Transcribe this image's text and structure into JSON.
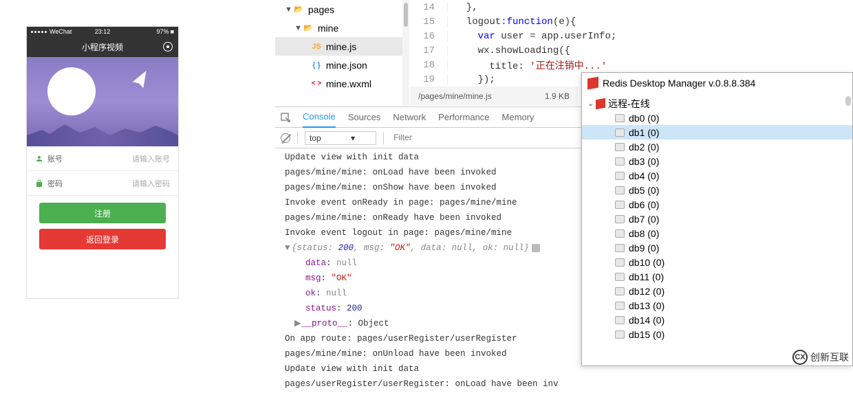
{
  "phone": {
    "statusbar": {
      "carrier": "WeChat",
      "time": "23:12",
      "battery": "97%"
    },
    "title": "小程序视频",
    "form": {
      "account_label": "账号",
      "account_placeholder": "请输入账号",
      "password_label": "密码",
      "password_placeholder": "请输入密码"
    },
    "buttons": {
      "register": "注册",
      "back_login": "返回登录"
    }
  },
  "filetree": {
    "folders": [
      "pages",
      "mine"
    ],
    "files": [
      {
        "icon": "JS",
        "name": "mine.js",
        "cls": "ic-js",
        "sel": true
      },
      {
        "icon": "{ }",
        "name": "mine.json",
        "cls": "ic-json",
        "sel": false
      },
      {
        "icon": "< >",
        "name": "mine.wxml",
        "cls": "ic-wxml",
        "sel": false
      }
    ]
  },
  "code": {
    "lines": [
      {
        "n": 14,
        "txt": "  },"
      },
      {
        "n": 15,
        "txt": "  logout:",
        "fn": "function",
        "after": "(e){"
      },
      {
        "n": 16,
        "txt": "    ",
        "kw": "var",
        "after": " user = app.userInfo;"
      },
      {
        "n": 17,
        "txt": "    wx.showLoading({"
      },
      {
        "n": 18,
        "txt": "      title: ",
        "str": "'正在注销中...'"
      },
      {
        "n": 19,
        "txt": "    });"
      }
    ]
  },
  "footer": {
    "path": "/pages/mine/mine.js",
    "size": "1.9 KB"
  },
  "devtools": {
    "tabs": [
      "Console",
      "Sources",
      "Network",
      "Performance",
      "Memory"
    ],
    "active_tab": 0,
    "context": "top",
    "filter_placeholder": "Filter",
    "log": [
      {
        "t": "plain",
        "v": "Update view with init data"
      },
      {
        "t": "plain",
        "v": "pages/mine/mine: onLoad have been invoked"
      },
      {
        "t": "plain",
        "v": "pages/mine/mine: onShow have been invoked"
      },
      {
        "t": "plain",
        "v": "Invoke event onReady in page: pages/mine/mine"
      },
      {
        "t": "plain",
        "v": "pages/mine/mine: onReady have been invoked"
      },
      {
        "t": "plain",
        "v": "Invoke event logout in page: pages/mine/mine"
      },
      {
        "t": "obj_head",
        "v": "{status: 200, msg: \"OK\", data: null, ok: null}"
      },
      {
        "t": "kv",
        "k": "data",
        "v": "null",
        "cls": "c-null"
      },
      {
        "t": "kv",
        "k": "msg",
        "v": "\"OK\"",
        "cls": "c-str"
      },
      {
        "t": "kv",
        "k": "ok",
        "v": "null",
        "cls": "c-null"
      },
      {
        "t": "kv",
        "k": "status",
        "v": "200",
        "cls": "c-num"
      },
      {
        "t": "proto",
        "v": "__proto__",
        "after": ": Object"
      },
      {
        "t": "plain",
        "v": "On app route: pages/userRegister/userRegister"
      },
      {
        "t": "plain",
        "v": "pages/mine/mine: onUnload have been invoked"
      },
      {
        "t": "plain",
        "v": "Update view with init data"
      },
      {
        "t": "plain",
        "v": "pages/userRegister/userRegister: onLoad have been inv"
      }
    ]
  },
  "redis": {
    "title": "Redis Desktop Manager v.0.8.8.384",
    "server": "远程-在线",
    "dbs": [
      "db0 (0)",
      "db1 (0)",
      "db2 (0)",
      "db3 (0)",
      "db4 (0)",
      "db5 (0)",
      "db6 (0)",
      "db7 (0)",
      "db8 (0)",
      "db9 (0)",
      "db10 (0)",
      "db11 (0)",
      "db12 (0)",
      "db13 (0)",
      "db14 (0)",
      "db15 (0)"
    ],
    "selected": 1
  },
  "watermark": "创新互联"
}
